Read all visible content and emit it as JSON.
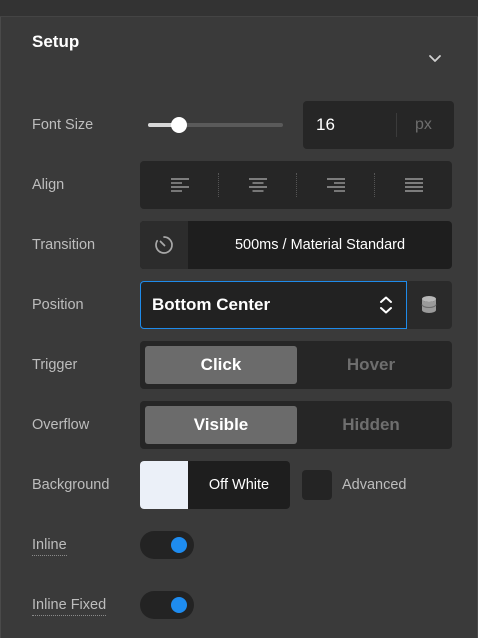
{
  "section": {
    "title": "Setup",
    "chevron_icon": "chevron-down-icon"
  },
  "font_size": {
    "label": "Font Size",
    "value": "16",
    "unit": "px",
    "slider_fraction": 0.23
  },
  "align": {
    "label": "Align",
    "options": [
      "align-left-icon",
      "align-center-icon",
      "align-right-icon",
      "align-justify-icon"
    ]
  },
  "transition": {
    "label": "Transition",
    "icon": "timer-icon",
    "value": "500ms / Material Standard"
  },
  "position": {
    "label": "Position",
    "value": "Bottom Center",
    "arrows_icon": "up-down-arrows-icon",
    "db_icon": "database-icon"
  },
  "trigger": {
    "label": "Trigger",
    "options": [
      "Click",
      "Hover"
    ],
    "selected": "Click"
  },
  "overflow": {
    "label": "Overflow",
    "options": [
      "Visible",
      "Hidden"
    ],
    "selected": "Visible"
  },
  "background": {
    "label": "Background",
    "swatch_color": "#ebf0f8",
    "value": "Off White",
    "advanced_label": "Advanced"
  },
  "inline": {
    "label": "Inline",
    "on": true
  },
  "inline_fixed": {
    "label": "Inline Fixed",
    "on": true
  },
  "colors": {
    "accent": "#1f8bea",
    "toggle_knob": "#1e8cf0"
  }
}
